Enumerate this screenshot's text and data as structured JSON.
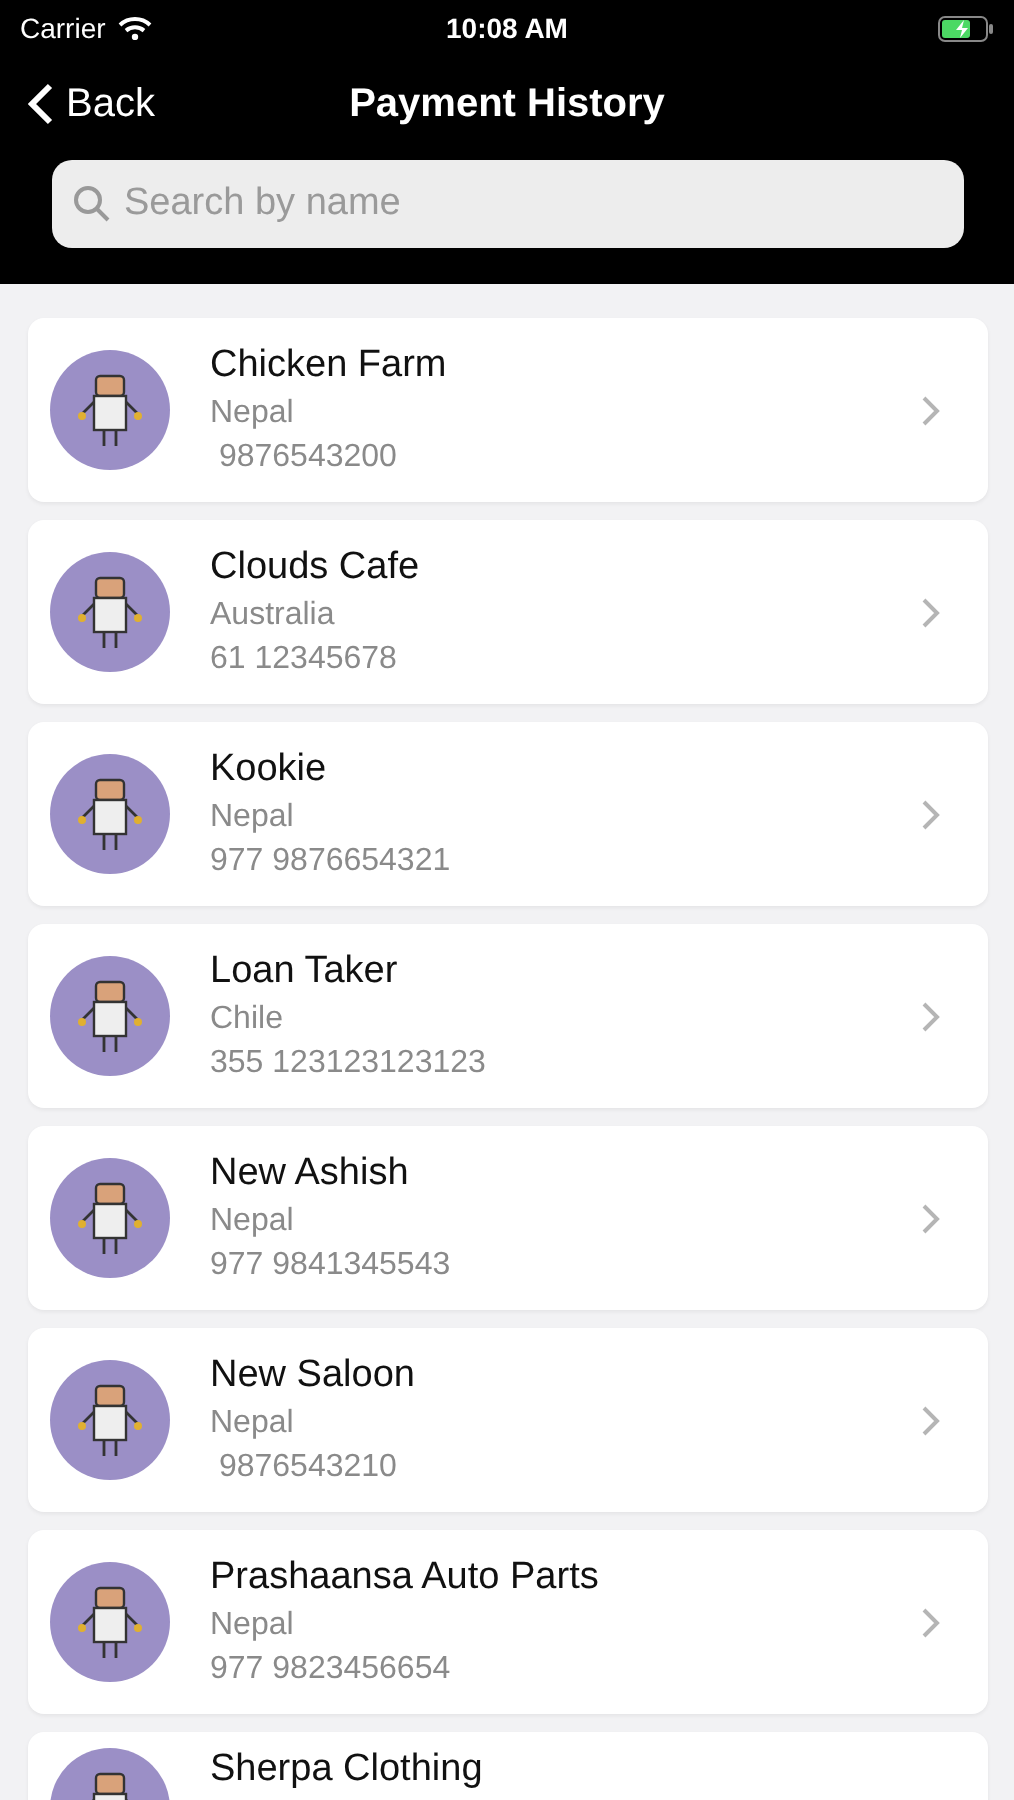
{
  "status_bar": {
    "carrier": "Carrier",
    "time": "10:08 AM"
  },
  "nav": {
    "back": "Back",
    "title": "Payment History"
  },
  "search": {
    "placeholder": "Search by name"
  },
  "contacts": [
    {
      "name": "Chicken Farm",
      "country": "Nepal",
      "phone": " 9876543200"
    },
    {
      "name": "Clouds Cafe",
      "country": "Australia",
      "phone": "61 12345678"
    },
    {
      "name": "Kookie",
      "country": "Nepal",
      "phone": "977 9876654321"
    },
    {
      "name": "Loan Taker",
      "country": "Chile",
      "phone": "355 123123123123"
    },
    {
      "name": "New Ashish",
      "country": "Nepal",
      "phone": "977 9841345543"
    },
    {
      "name": "New Saloon",
      "country": "Nepal",
      "phone": " 9876543210"
    },
    {
      "name": "Prashaansa Auto Parts",
      "country": "Nepal",
      "phone": "977 9823456654"
    },
    {
      "name": "Sherpa Clothing"
    }
  ]
}
